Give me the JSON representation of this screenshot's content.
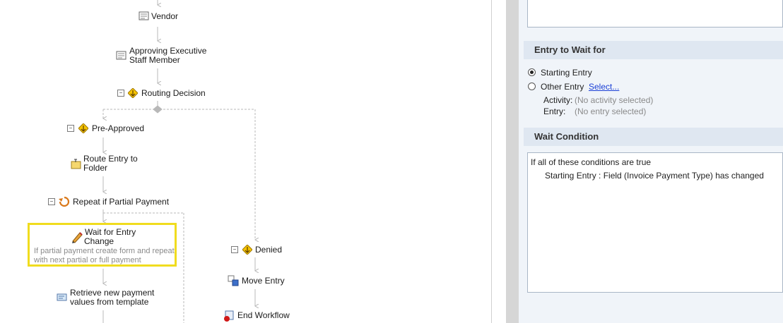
{
  "workflow": {
    "nodes": {
      "vendor": "Vendor",
      "approving_1": "Approving Executive",
      "approving_2": "Staff Member",
      "routing_decision": "Routing Decision",
      "pre_approved": "Pre-Approved",
      "route_entry_1": "Route Entry to",
      "route_entry_2": "Folder",
      "repeat": "Repeat if Partial Payment",
      "wait_1": "Wait for Entry",
      "wait_2": "Change",
      "wait_note_1": "If partial payment create form and repeat",
      "wait_note_2": "with next partial or full payment",
      "retrieve_1": "Retrieve new payment",
      "retrieve_2": "values from template",
      "denied": "Denied",
      "move_entry": "Move Entry",
      "end_workflow": "End Workflow"
    },
    "collapse_glyph": "−"
  },
  "panel": {
    "entry_section": {
      "title": "Entry to Wait for",
      "starting_entry": "Starting Entry",
      "other_entry": "Other Entry",
      "select_link": "Select...",
      "activity_label": "Activity:",
      "activity_value": "(No activity selected)",
      "entry_label": "Entry:",
      "entry_value": "(No entry selected)",
      "selected_option": "Starting Entry"
    },
    "condition_section": {
      "title": "Wait Condition",
      "header_line": "If all of these conditions are true",
      "condition_line": "Starting Entry : Field (Invoice Payment Type) has changed"
    }
  },
  "colors": {
    "highlight": "#f0dc1e",
    "connector": "#b8b8b8",
    "link": "#1a3fd6",
    "section_header_bg": "#dfe7f1"
  }
}
